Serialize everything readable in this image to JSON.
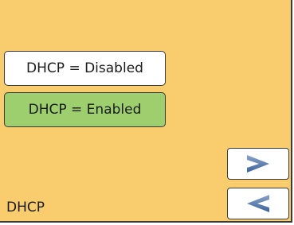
{
  "options": {
    "disabled_label": "DHCP = Disabled",
    "enabled_label": "DHCP = Enabled"
  },
  "navigation": {
    "next_icon": "chevron-right-icon",
    "prev_icon": "chevron-left-icon"
  },
  "screen": {
    "label": "DHCP"
  },
  "colors": {
    "background": "#f9cd6e",
    "selected_option": "#9ecf6f",
    "unselected_option": "#ffffff",
    "arrow": "#4a6fa5"
  }
}
